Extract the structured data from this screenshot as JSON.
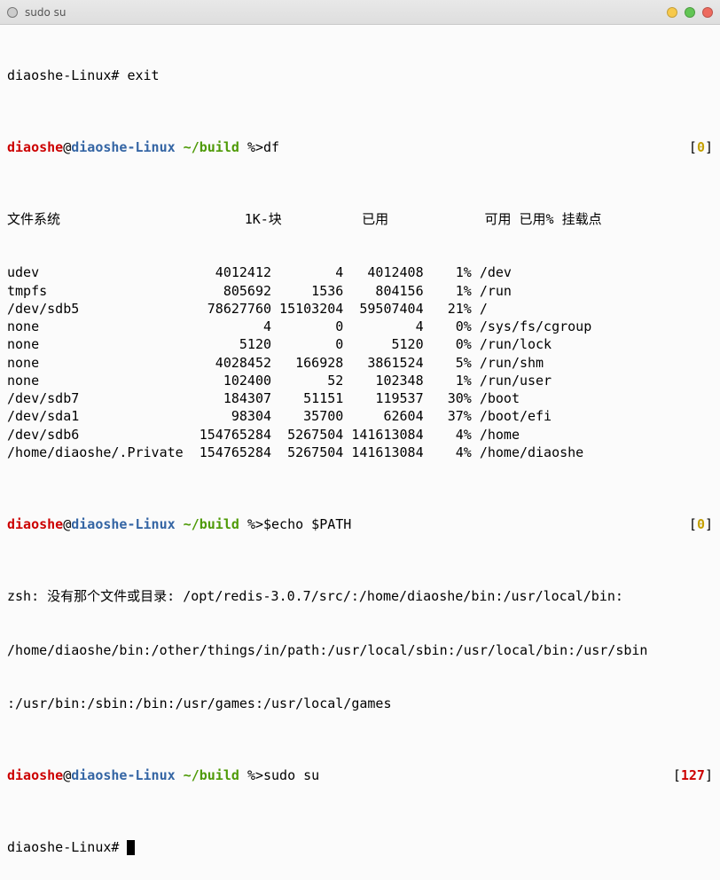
{
  "window": {
    "title": "sudo su"
  },
  "lines": {
    "rootprompt1": "diaoshe-Linux# ",
    "exitcmd": "exit",
    "rootprompt2": "diaoshe-Linux# "
  },
  "prompt": {
    "user": "diaoshe",
    "at": "@",
    "host": "diaoshe-Linux",
    "path": " ~/build ",
    "sep": "%>"
  },
  "cmds": {
    "df": "df",
    "echo_path": "$echo $PATH",
    "sudo": "sudo su"
  },
  "status": {
    "s0": "0",
    "s127": "127"
  },
  "df": {
    "header": {
      "fs": "文件系统",
      "blocks": "1K-块",
      "used": "已用",
      "avail": "可用",
      "usep": "已用%",
      "mount": "挂载点"
    },
    "rows": [
      {
        "fs": "udev",
        "blocks": "4012412",
        "used": "4",
        "avail": "4012408",
        "usep": "1%",
        "mount": "/dev"
      },
      {
        "fs": "tmpfs",
        "blocks": "805692",
        "used": "1536",
        "avail": "804156",
        "usep": "1%",
        "mount": "/run"
      },
      {
        "fs": "/dev/sdb5",
        "blocks": "78627760",
        "used": "15103204",
        "avail": "59507404",
        "usep": "21%",
        "mount": "/"
      },
      {
        "fs": "none",
        "blocks": "4",
        "used": "0",
        "avail": "4",
        "usep": "0%",
        "mount": "/sys/fs/cgroup"
      },
      {
        "fs": "none",
        "blocks": "5120",
        "used": "0",
        "avail": "5120",
        "usep": "0%",
        "mount": "/run/lock"
      },
      {
        "fs": "none",
        "blocks": "4028452",
        "used": "166928",
        "avail": "3861524",
        "usep": "5%",
        "mount": "/run/shm"
      },
      {
        "fs": "none",
        "blocks": "102400",
        "used": "52",
        "avail": "102348",
        "usep": "1%",
        "mount": "/run/user"
      },
      {
        "fs": "/dev/sdb7",
        "blocks": "184307",
        "used": "51151",
        "avail": "119537",
        "usep": "30%",
        "mount": "/boot"
      },
      {
        "fs": "/dev/sda1",
        "blocks": "98304",
        "used": "35700",
        "avail": "62604",
        "usep": "37%",
        "mount": "/boot/efi"
      },
      {
        "fs": "/dev/sdb6",
        "blocks": "154765284",
        "used": "5267504",
        "avail": "141613084",
        "usep": "4%",
        "mount": "/home"
      },
      {
        "fs": "/home/diaoshe/.Private",
        "blocks": "154765284",
        "used": "5267504",
        "avail": "141613084",
        "usep": "4%",
        "mount": "/home/diaoshe"
      }
    ]
  },
  "zsh_error": {
    "l1": "zsh: 没有那个文件或目录: /opt/redis-3.0.7/src/:/home/diaoshe/bin:/usr/local/bin:",
    "l2": "/home/diaoshe/bin:/other/things/in/path:/usr/local/sbin:/usr/local/bin:/usr/sbin",
    "l3": ":/usr/bin:/sbin:/bin:/usr/games:/usr/local/games"
  },
  "cols": {
    "fs_w": 23,
    "blocks_w": 10,
    "used_w": 9,
    "avail_w": 10,
    "usep_w": 6
  }
}
